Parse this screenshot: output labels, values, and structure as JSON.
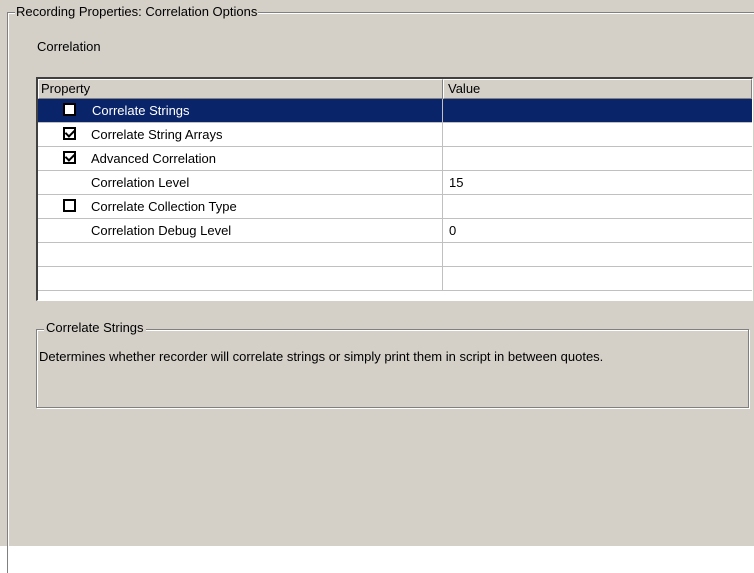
{
  "group_title": "Recording Properties: Correlation Options",
  "section_label": "Correlation",
  "grid": {
    "columns": {
      "property": "Property",
      "value": "Value"
    },
    "rows": [
      {
        "label": "Correlate Strings",
        "checkbox": true,
        "checked": false,
        "value": "",
        "selected": true
      },
      {
        "label": "Correlate String Arrays",
        "checkbox": true,
        "checked": true,
        "value": ""
      },
      {
        "label": "Advanced Correlation",
        "checkbox": true,
        "checked": true,
        "value": ""
      },
      {
        "label": "Correlation Level",
        "checkbox": false,
        "value": "15"
      },
      {
        "label": "Correlate Collection Type",
        "checkbox": true,
        "checked": false,
        "value": ""
      },
      {
        "label": "Correlation Debug Level",
        "checkbox": false,
        "value": "0"
      }
    ]
  },
  "description": {
    "title": "Correlate Strings",
    "text": "Determines whether recorder will correlate strings or simply print them in script in between quotes."
  },
  "colors": {
    "selection": "#0a246a",
    "face": "#d4d0c8"
  }
}
